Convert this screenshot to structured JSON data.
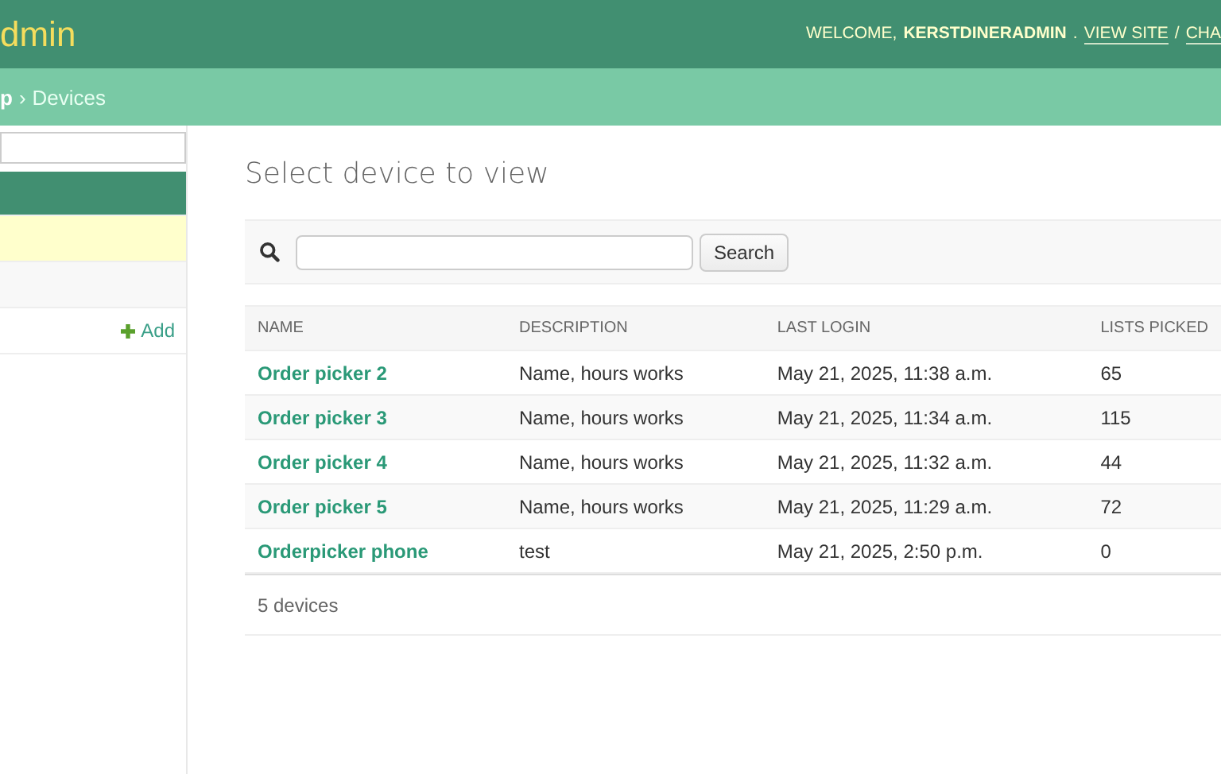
{
  "header": {
    "site_title": "dmin",
    "welcome": "WELCOME,",
    "user": "KERSTDINERADMIN",
    "user_end": ".",
    "links": [
      "VIEW SITE",
      "CHA"
    ],
    "link_separator": "/"
  },
  "breadcrumbs": [
    "p",
    "Devices"
  ],
  "breadcrumb_separator": "›",
  "sidebar": {
    "items": [
      {
        "kind": "caption"
      },
      {
        "kind": "model",
        "selected": true
      },
      {
        "kind": "model",
        "selected": false
      },
      {
        "kind": "model",
        "selected": false,
        "add_label": "Add"
      }
    ]
  },
  "content": {
    "title": "Select device to view",
    "search_button": "Search",
    "table": {
      "columns": [
        "NAME",
        "DESCRIPTION",
        "LAST LOGIN",
        "LISTS PICKED"
      ],
      "rows": [
        [
          "Order picker 2",
          "Name, hours works",
          "May 21, 2025, 11:38 a.m.",
          "65"
        ],
        [
          "Order picker 3",
          "Name, hours works",
          "May 21, 2025, 11:34 a.m.",
          "115"
        ],
        [
          "Order picker 4",
          "Name, hours works",
          "May 21, 2025, 11:32 a.m.",
          "44"
        ],
        [
          "Order picker 5",
          "Name, hours works",
          "May 21, 2025, 11:29 a.m.",
          "72"
        ],
        [
          "Orderpicker phone",
          "test",
          "May 21, 2025, 2:50 p.m.",
          "0"
        ]
      ]
    },
    "count": "5 devices"
  }
}
